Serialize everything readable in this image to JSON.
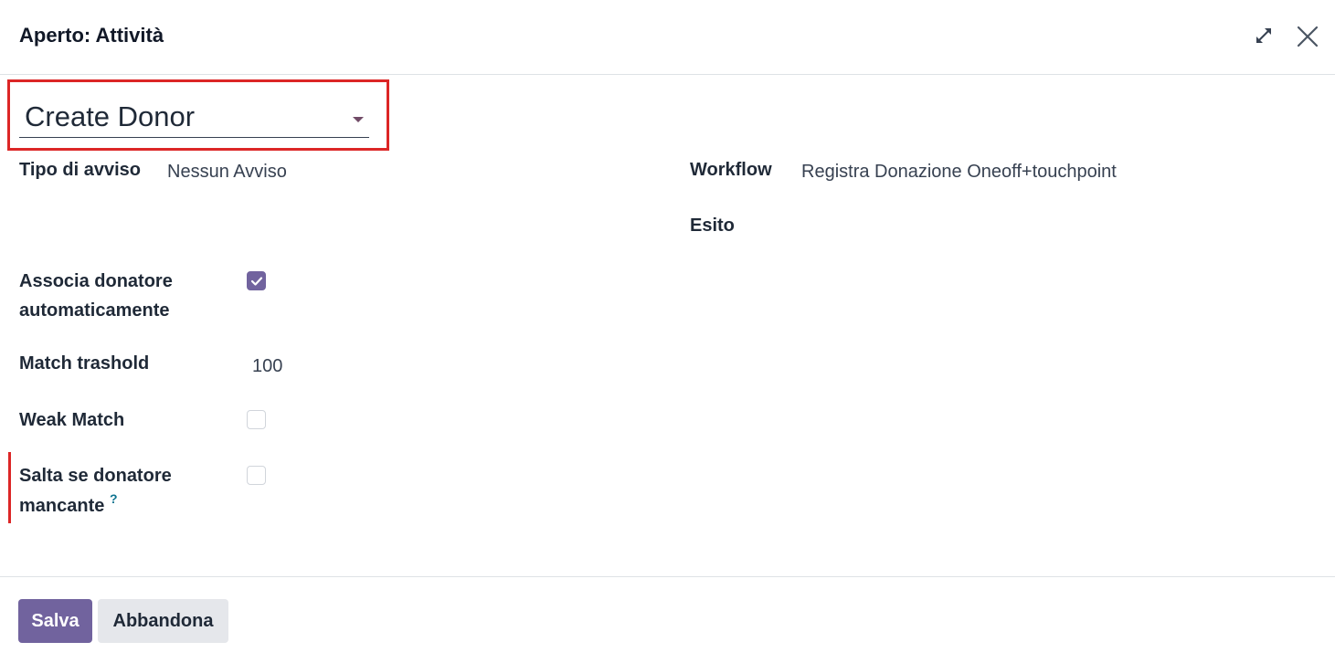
{
  "dialog": {
    "title": "Aperto: Attività"
  },
  "form": {
    "name_value": "Create Donor",
    "tipo_avviso": {
      "label": "Tipo di avviso",
      "value": "Nessun Avviso"
    },
    "workflow": {
      "label": "Workflow",
      "value": "Registra Donazione Oneoff+touchpoint"
    },
    "esito": {
      "label": "Esito",
      "value": ""
    },
    "associa": {
      "label_line1": "Associa donatore",
      "label_line2": "automaticamente",
      "checked": true
    },
    "match_trashold": {
      "label": "Match trashold",
      "value": "100"
    },
    "weak_match": {
      "label": "Weak Match",
      "checked": false
    },
    "salta": {
      "label_line1": "Salta se donatore",
      "label_line2": "mancante",
      "help": "?",
      "checked": false
    }
  },
  "footer": {
    "save_label": "Salva",
    "discard_label": "Abbandona"
  },
  "icons": {
    "expand": "expand-icon",
    "close": "close-icon",
    "caret": "caret-down-icon",
    "check": "check-icon"
  },
  "colors": {
    "primary": "#71639e",
    "highlight": "#dc2626",
    "help": "#0e7490"
  }
}
